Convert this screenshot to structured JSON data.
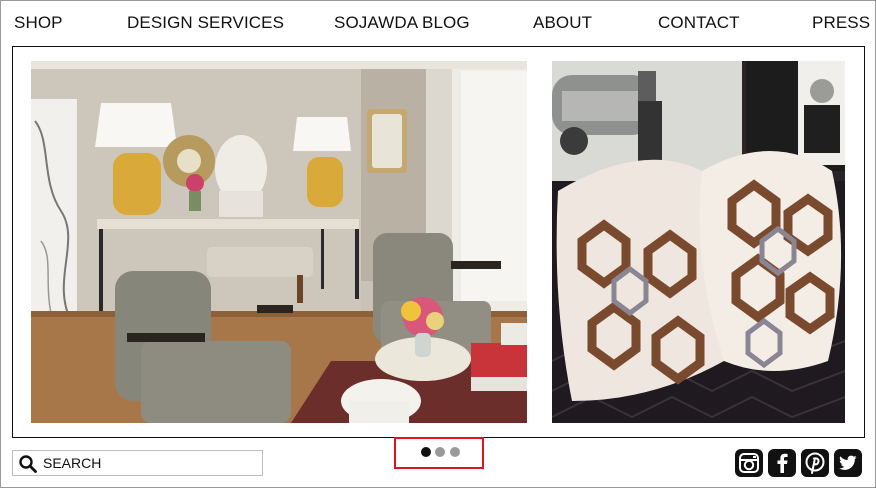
{
  "nav": {
    "items": [
      {
        "label": "SHOP"
      },
      {
        "label": "DESIGN SERVICES"
      },
      {
        "label": "SOJAWDA BLOG"
      },
      {
        "label": "ABOUT"
      },
      {
        "label": "CONTACT"
      },
      {
        "label": "PRESS"
      }
    ]
  },
  "slider": {
    "slide_count": 3,
    "active_slide": 1
  },
  "search": {
    "placeholder": "SEARCH",
    "value": ""
  },
  "social": {
    "icons": [
      "instagram-icon",
      "facebook-icon",
      "pinterest-icon",
      "twitter-icon"
    ]
  },
  "colors": {
    "dot_active": "#111111",
    "dot_inactive": "#9a9a9a",
    "highlight_border": "#e0141e",
    "social_bg": "#111111"
  }
}
